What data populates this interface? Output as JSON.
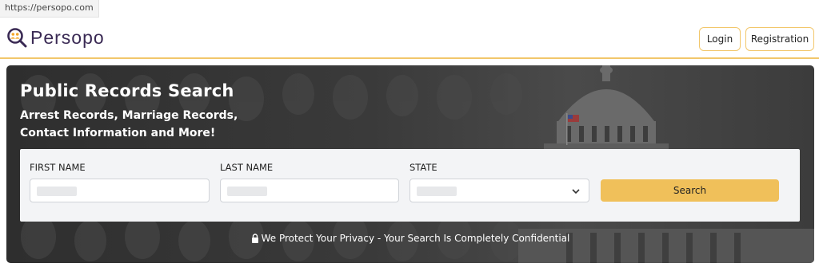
{
  "browser": {
    "url": "https://persopo.com"
  },
  "header": {
    "brand": "Persopo",
    "login_label": "Login",
    "registration_label": "Registration"
  },
  "hero": {
    "title": "Public Records Search",
    "subtitle_line1": "Arrest Records, Marriage Records,",
    "subtitle_line2": "Contact Information and More!"
  },
  "form": {
    "first_name_label": "FIRST NAME",
    "last_name_label": "LAST NAME",
    "state_label": "STATE",
    "search_label": "Search"
  },
  "privacy_text": "We Protect Your Privacy - Your Search Is Completely Confidential",
  "colors": {
    "accent": "#f0c05a",
    "brand_text": "#3a2a54",
    "logo_orange": "#f4a62a"
  },
  "icons": [
    "persopo-logo-icon",
    "chevron-down-icon",
    "lock-icon"
  ]
}
